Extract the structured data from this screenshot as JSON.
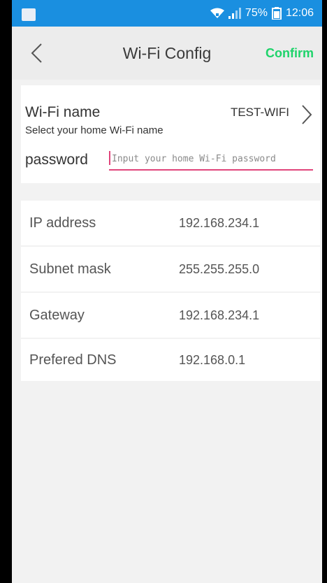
{
  "status_bar": {
    "battery": "75%",
    "time": "12:06"
  },
  "header": {
    "title": "Wi-Fi Config",
    "confirm_label": "Confirm",
    "back_icon": "chevron-left-icon"
  },
  "wifi": {
    "name_label": "Wi-Fi name",
    "name_hint": "Select your home Wi-Fi name",
    "name_value": "TEST-WIFI",
    "password_label": "password",
    "password_value": "",
    "password_placeholder": "Input your home Wi-Fi password"
  },
  "network": {
    "rows": [
      {
        "label": "IP address",
        "value": "192.168.234.1"
      },
      {
        "label": "Subnet mask",
        "value": "255.255.255.0"
      },
      {
        "label": "Gateway",
        "value": "192.168.234.1"
      },
      {
        "label": "Prefered DNS",
        "value": "192.168.0.1"
      }
    ]
  },
  "colors": {
    "status_bar": "#1a8fe0",
    "confirm": "#1ed36a",
    "input_underline": "#e0457b"
  }
}
